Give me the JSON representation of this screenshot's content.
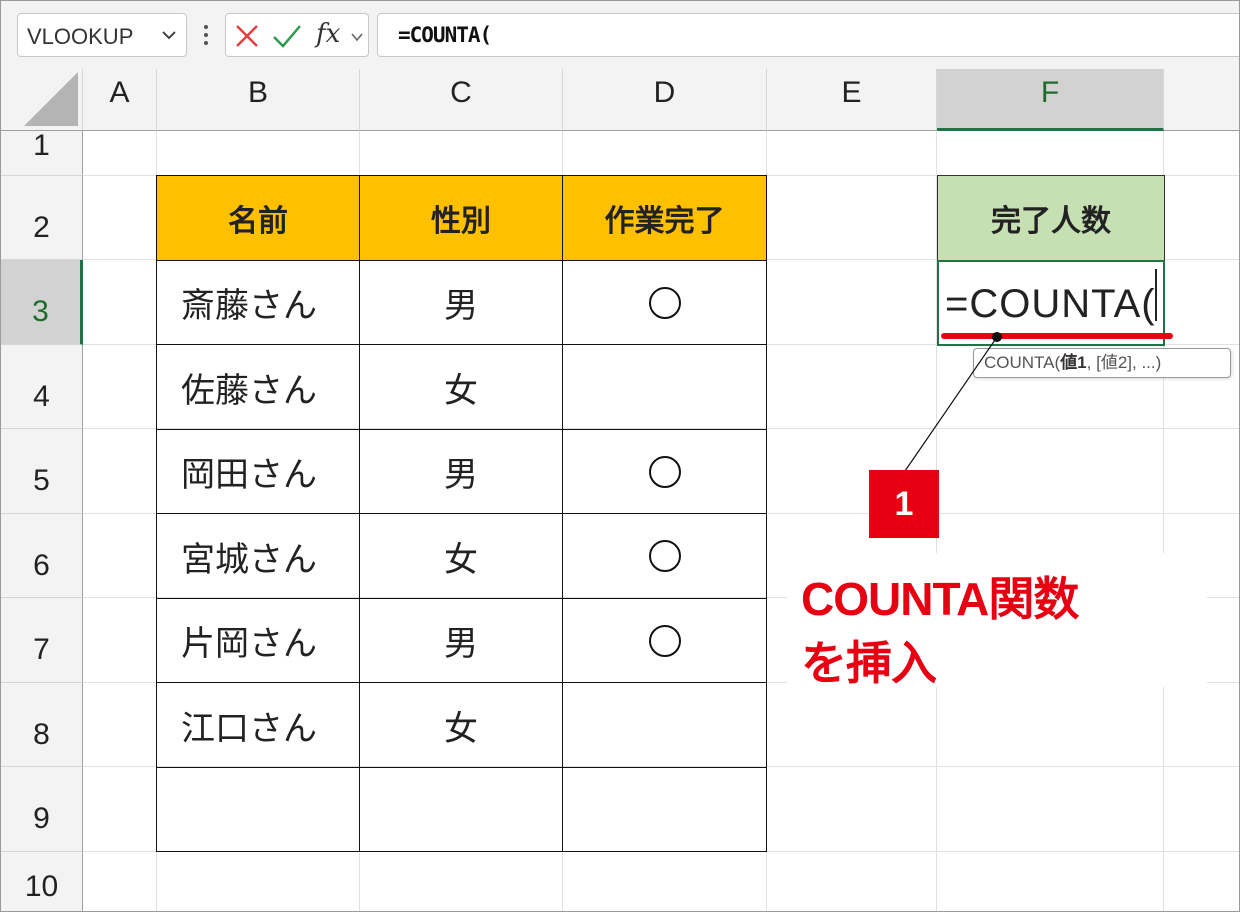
{
  "formula_bar": {
    "name_box": "VLOOKUP",
    "cancel_icon": "x-icon",
    "enter_icon": "check-icon",
    "fx_label": "fx",
    "formula": "=COUNTA("
  },
  "columns": [
    "A",
    "B",
    "C",
    "D",
    "E",
    "F"
  ],
  "rows": [
    "1",
    "2",
    "3",
    "4",
    "5",
    "6",
    "7",
    "8",
    "9",
    "10"
  ],
  "table": {
    "headers": [
      "名前",
      "性別",
      "作業完了"
    ],
    "rows": [
      {
        "name": "斎藤さん",
        "gender": "男",
        "done": true
      },
      {
        "name": "佐藤さん",
        "gender": "女",
        "done": false
      },
      {
        "name": "岡田さん",
        "gender": "男",
        "done": true
      },
      {
        "name": "宮城さん",
        "gender": "女",
        "done": true
      },
      {
        "name": "片岡さん",
        "gender": "男",
        "done": true
      },
      {
        "name": "江口さん",
        "gender": "女",
        "done": false
      }
    ]
  },
  "summary": {
    "header": "完了人数",
    "active_cell_text": "=COUNTA(",
    "tooltip_fn": "COUNTA(",
    "tooltip_arg1": "値1",
    "tooltip_rest": ", [値2], ...)"
  },
  "annotation": {
    "step": "1",
    "line1": "COUNTA関数",
    "line2": "を挿入",
    "accent": "#e60012"
  }
}
